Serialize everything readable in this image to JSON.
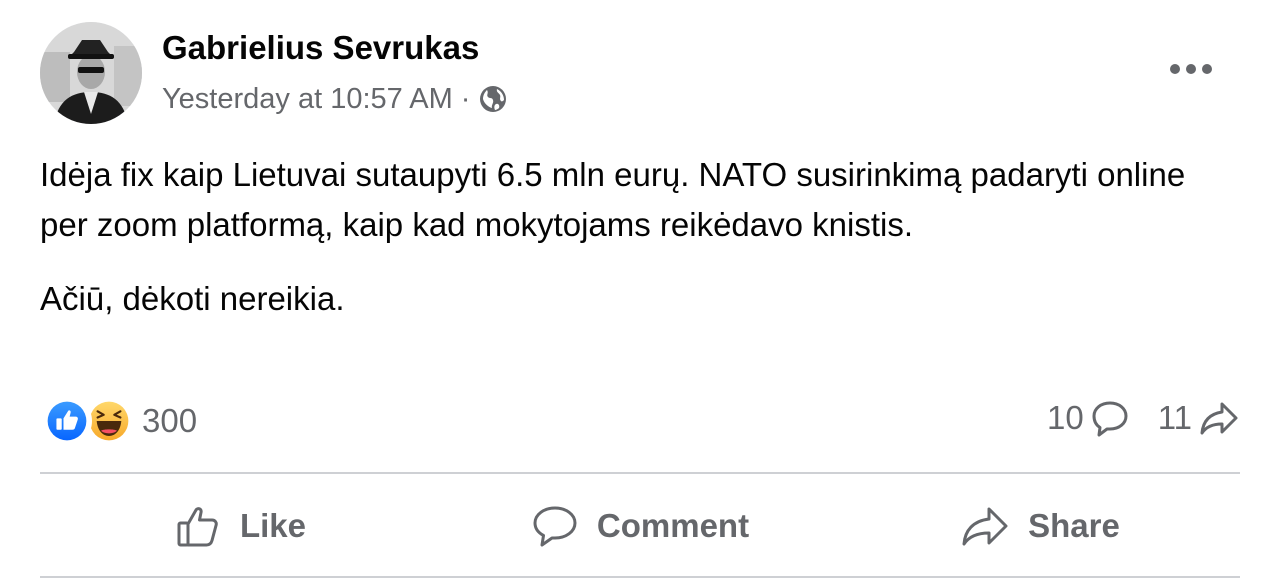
{
  "post": {
    "author": "Gabrielius Sevrukas",
    "timestamp": "Yesterday at 10:57 AM",
    "separator": "·",
    "privacy_icon": "globe-icon",
    "more_icon": "more-options-icon",
    "paragraphs": [
      "Idėja fix kaip Lietuvai sutaupyti 6.5 mln eurų. NATO susirinkimą padaryti online per zoom platformą, kaip kad mokytojams reikėdavo knistis.",
      "Ačiū, dėkoti nereikia."
    ]
  },
  "stats": {
    "reactions": [
      "like-reaction-icon",
      "haha-reaction-icon"
    ],
    "reaction_count": "300",
    "comment_count": "10",
    "share_count": "11"
  },
  "actions": {
    "like_label": "Like",
    "comment_label": "Comment",
    "share_label": "Share"
  },
  "colors": {
    "text_primary": "#050505",
    "text_secondary": "#65676b",
    "like_blue": "#1877f2",
    "haha_yellow": "#f7b125",
    "divider": "#ced0d4"
  }
}
